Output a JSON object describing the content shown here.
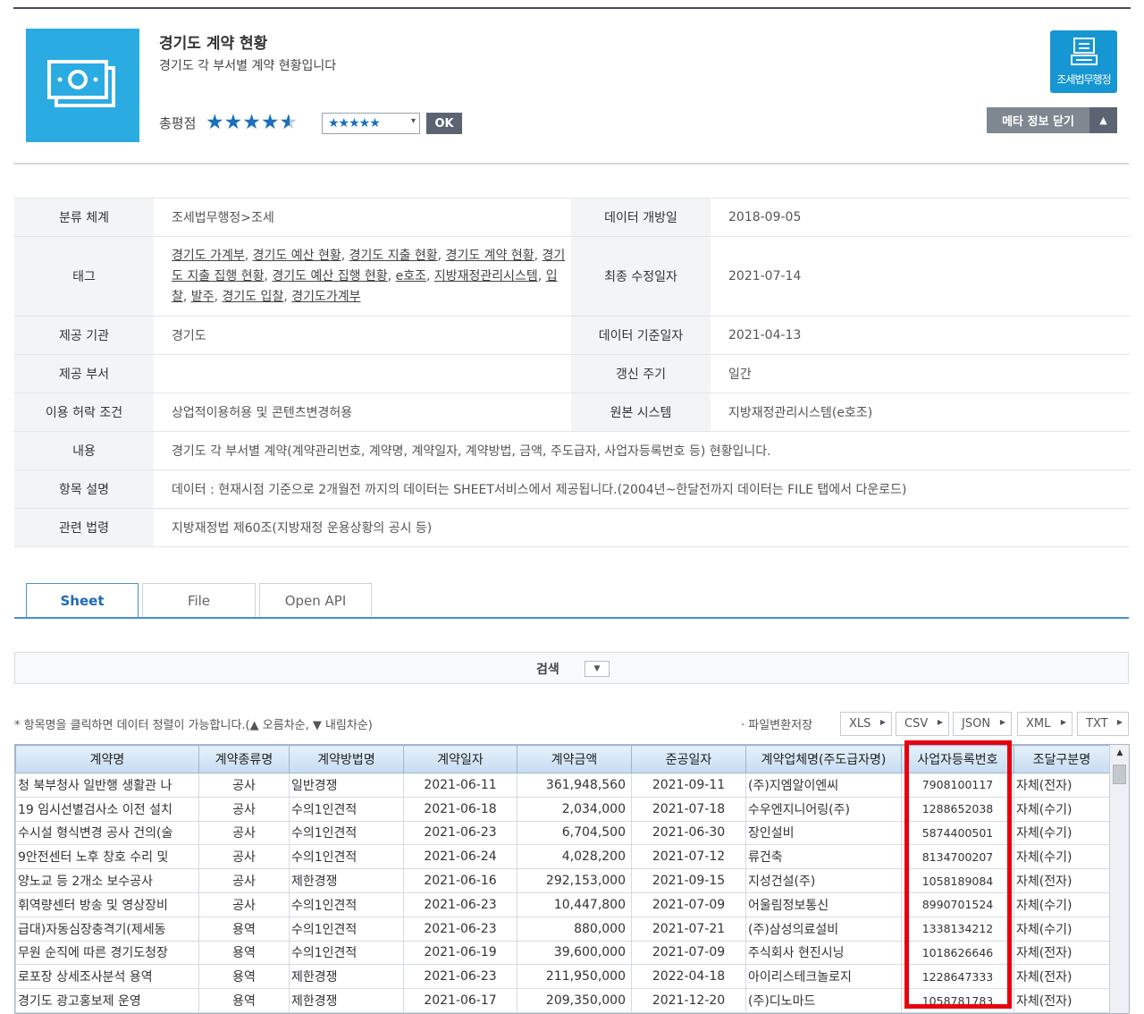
{
  "header": {
    "title": "경기도 계약 현황",
    "subtitle": "경기도 각 부서별 계약 현황입니다",
    "rating_label": "총평점",
    "rating_stars": 4.5,
    "rating_select_value": "★★★★★",
    "ok_label": "OK",
    "badge_label": "조세법무행정",
    "meta_toggle_label": "메타 정보 닫기"
  },
  "meta": {
    "rows": [
      {
        "k1": "분류 체계",
        "v1": "조세법무행정>조세",
        "k2": "데이터 개방일",
        "v2": "2018-09-05"
      },
      {
        "k1": "태그",
        "k2": "최종 수정일자",
        "v2": "2021-07-14"
      },
      {
        "k1": "제공 기관",
        "v1": "경기도",
        "k2": "데이터 기준일자",
        "v2": "2021-04-13"
      },
      {
        "k1": "제공 부서",
        "v1": "",
        "k2": "갱신 주기",
        "v2": "일간"
      },
      {
        "k1": "이용 허락 조건",
        "v1": "상업적이용허용 및 콘텐츠변경허용",
        "k2": "원본 시스템",
        "v2": "지방재정관리시스템(e호조)"
      },
      {
        "k1": "내용",
        "v1": "경기도 각 부서별 계약(계약관리번호, 계약명, 계약일자, 계약방법, 금액, 주도급자, 사업자등록번호 등) 현황입니다."
      },
      {
        "k1": "항목 설명",
        "v1": "데이터 : 현재시점 기준으로 2개월전 까지의 데이터는 SHEET서비스에서 제공됩니다.(2004년~한달전까지 데이터는 FILE 탭에서 다운로드)"
      },
      {
        "k1": "관련 법령",
        "v1": "지방재정법 제60조(지방재정 운용상황의 공시 등)"
      }
    ],
    "tags": [
      "경기도 가계부",
      "경기도 예산 현황",
      "경기도 지출 현황",
      "경기도 계약 현황",
      "경기도 지출 집행 현황",
      "경기도 예산 집행 현황",
      "e호조",
      "지방재정관리시스템",
      "입찰",
      "발주",
      "경기도 입찰",
      "경기도가계부"
    ]
  },
  "tabs": [
    "Sheet",
    "File",
    "Open API"
  ],
  "search": {
    "label": "검색"
  },
  "sort_hint": "* 항목명을 클릭하면 데이터 정렬이 가능합니다.(▲ 오름차순, ▼ 내림차순)",
  "export": {
    "label": "· 파일변환저장",
    "formats": [
      "XLS",
      "CSV",
      "JSON",
      "XML",
      "TXT"
    ]
  },
  "grid": {
    "columns": [
      "계약명",
      "계약종류명",
      "계약방법명",
      "계약일자",
      "계약금액",
      "준공일자",
      "계약업체명(주도급자명)",
      "사업자등록번호",
      "조달구분명"
    ],
    "rows": [
      [
        "청 북부청사 일반행 생활관 나",
        "공사",
        "일반경쟁",
        "2021-06-11",
        "361,948,560",
        "2021-09-11",
        "(주)지엠알이엔씨",
        "7908100117",
        "자체(전자)"
      ],
      [
        "19 임시선별검사소 이전 설치",
        "공사",
        "수의1인견적",
        "2021-06-18",
        "2,034,000",
        "2021-07-18",
        "수우엔지니어링(주)",
        "1288652038",
        "자체(수기)"
      ],
      [
        "수시설 형식변경 공사 건의(술",
        "공사",
        "수의1인견적",
        "2021-06-23",
        "6,704,500",
        "2021-06-30",
        "장인설비",
        "5874400501",
        "자체(수기)"
      ],
      [
        "9안전센터 노후 창호 수리 및",
        "공사",
        "수의1인견적",
        "2021-06-24",
        "4,028,200",
        "2021-07-12",
        "류건축",
        "8134700207",
        "자체(수기)"
      ],
      [
        "양노교 등 2개소 보수공사",
        "공사",
        "제한경쟁",
        "2021-06-16",
        "292,153,000",
        "2021-09-15",
        "지성건설(주)",
        "1058189084",
        "자체(전자)"
      ],
      [
        "휘역량센터 방송 및 영상장비",
        "공사",
        "수의1인견적",
        "2021-06-23",
        "10,447,800",
        "2021-07-09",
        "어울림정보통신",
        "8990701524",
        "자체(수기)"
      ],
      [
        "급대)자동심장충격기(제세동",
        "용역",
        "수의1인견적",
        "2021-06-23",
        "880,000",
        "2021-07-21",
        "(주)삼성의료설비",
        "1338134212",
        "자체(수기)"
      ],
      [
        "무원 순직에 따른 경기도청장",
        "용역",
        "수의1인견적",
        "2021-06-19",
        "39,600,000",
        "2021-07-09",
        "주식회사 현진시닝",
        "1018626646",
        "자체(전자)"
      ],
      [
        "로포장 상세조사분석 용역",
        "용역",
        "제한경쟁",
        "2021-06-23",
        "211,950,000",
        "2022-04-18",
        "아이리스테크놀로지",
        "1228647333",
        "자체(전자)"
      ],
      [
        "경기도 광고홍보제 운영",
        "용역",
        "제한경쟁",
        "2021-06-17",
        "209,350,000",
        "2021-12-20",
        "(주)디노마드",
        "1058781783",
        "자체(전자)"
      ]
    ]
  }
}
